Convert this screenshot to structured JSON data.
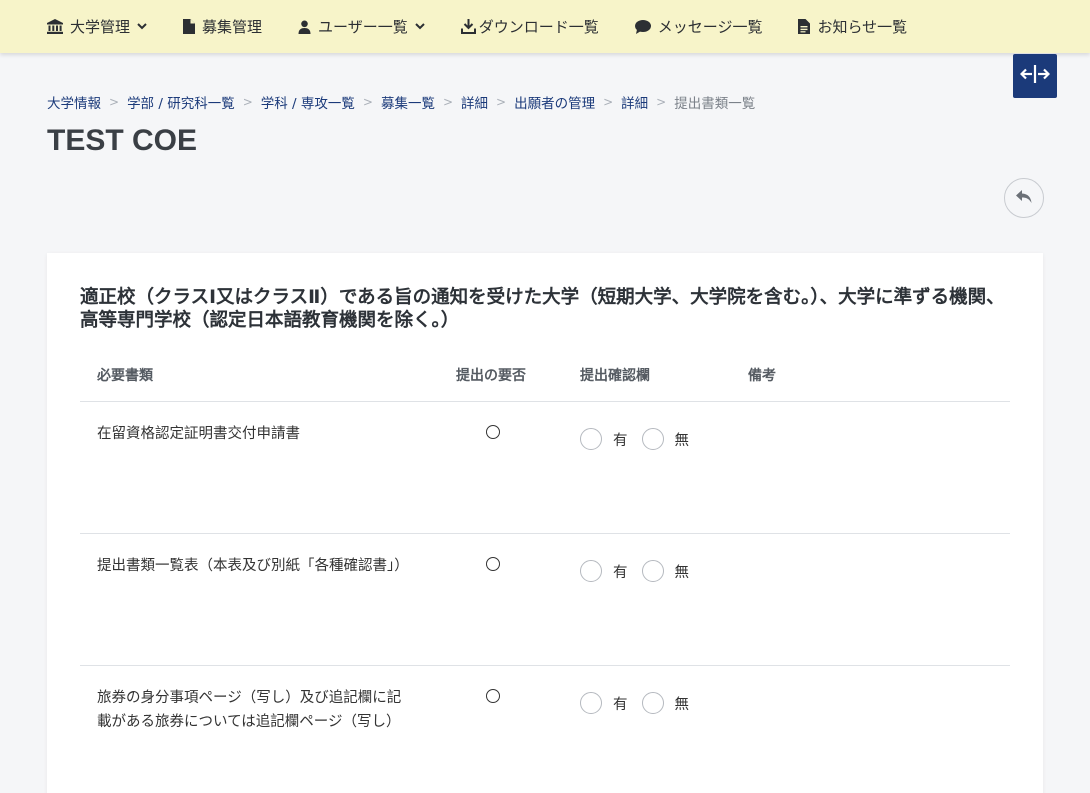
{
  "nav": {
    "items": [
      {
        "label": "大学管理",
        "icon": "university-icon",
        "dropdown": true
      },
      {
        "label": "募集管理",
        "icon": "file-icon",
        "dropdown": false
      },
      {
        "label": "ユーザー一覧",
        "icon": "user-icon",
        "dropdown": true
      },
      {
        "label": "ダウンロード一覧",
        "icon": "download-icon",
        "dropdown": false
      },
      {
        "label": "メッセージ一覧",
        "icon": "comment-icon",
        "dropdown": false
      },
      {
        "label": "お知らせ一覧",
        "icon": "document-icon",
        "dropdown": false
      }
    ],
    "background": "#f7f4c9"
  },
  "breadcrumb": {
    "items": [
      "大学情報",
      "学部 / 研究科一覧",
      "学科 / 専攻一覧",
      "募集一覧",
      "詳細",
      "出願者の管理",
      "詳細"
    ],
    "current": "提出書類一覧"
  },
  "page_title": "TEST COE",
  "accent_color": "#1b3a7a",
  "card": {
    "title": "適正校（クラスⅠ又はクラスⅡ）である旨の通知を受けた大学（短期大学、大学院を含む。）、大学に準ずる機関、高等専門学校（認定日本語教育機関を除く。）",
    "columns": [
      "必要書類",
      "提出の要否",
      "提出確認欄",
      "備考"
    ],
    "radio_labels": {
      "yes": "有",
      "no": "無"
    },
    "rows": [
      {
        "document": "在留資格認定証明書交付申請書",
        "required": "○"
      },
      {
        "document": "提出書類一覧表（本表及び別紙「各種確認書」）",
        "required": "○"
      },
      {
        "document": "旅券の身分事項ページ（写し）及び追記欄に記載がある旅券については追記欄ページ（写し）",
        "required": "○"
      }
    ]
  }
}
